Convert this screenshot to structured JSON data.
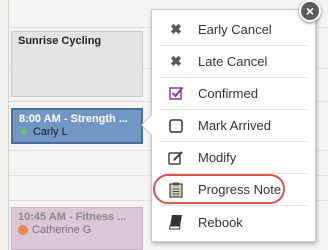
{
  "calendar": {
    "events": [
      {
        "title": "Sunrise Cycling",
        "person": ""
      },
      {
        "title": "8:00 AM - Strength ...",
        "person": "Carly L"
      },
      {
        "title": "10:45 AM - Fitness ...",
        "person": "Catherine G"
      }
    ]
  },
  "popup": {
    "close_label": "×",
    "items": [
      {
        "label": "Early Cancel",
        "icon": "x-icon"
      },
      {
        "label": "Late Cancel",
        "icon": "x-icon"
      },
      {
        "label": "Confirmed",
        "icon": "checkbox-checked-icon"
      },
      {
        "label": "Mark Arrived",
        "icon": "checkbox-empty-icon"
      },
      {
        "label": "Modify",
        "icon": "edit-icon"
      },
      {
        "label": "Progress Note",
        "icon": "document-icon"
      },
      {
        "label": "Rebook",
        "icon": "book-icon"
      }
    ],
    "highlighted_item": "Progress Note"
  },
  "colors": {
    "event_strength": "#7397c4",
    "event_fitness": "#dcc7d6",
    "highlight": "#d9534f",
    "confirmed_check": "#8b3d9a"
  }
}
